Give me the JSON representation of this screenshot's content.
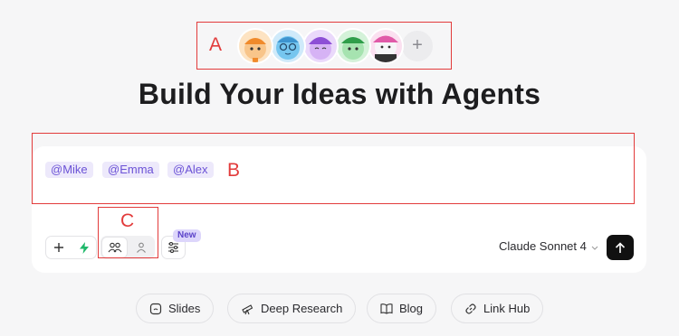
{
  "annotations": {
    "a": "A",
    "b": "B",
    "c": "C"
  },
  "avatars": [
    {
      "icon": "orange-agent-avatar-icon",
      "color": "#f5a04a"
    },
    {
      "icon": "blue-glasses-agent-avatar-icon",
      "color": "#5db8e8"
    },
    {
      "icon": "purple-agent-avatar-icon",
      "color": "#b27be6"
    },
    {
      "icon": "green-agent-avatar-icon",
      "color": "#4dbf63"
    },
    {
      "icon": "pink-agent-avatar-icon",
      "color": "#e86fb8"
    }
  ],
  "avatar_add_label": "+",
  "title": "Build Your Ideas with Agents",
  "mentions": [
    "@Mike",
    "@Emma",
    "@Alex"
  ],
  "toolbar": {
    "new_badge": "New",
    "model": "Claude Sonnet 4"
  },
  "chips": [
    {
      "label": "Slides",
      "icon": "slides-icon"
    },
    {
      "label": "Deep Research",
      "icon": "telescope-icon"
    },
    {
      "label": "Blog",
      "icon": "book-icon"
    },
    {
      "label": "Link Hub",
      "icon": "link-icon"
    }
  ],
  "colors": {
    "accent": "#6b52d6",
    "annotation": "#e23b3b",
    "send": "#111111"
  }
}
